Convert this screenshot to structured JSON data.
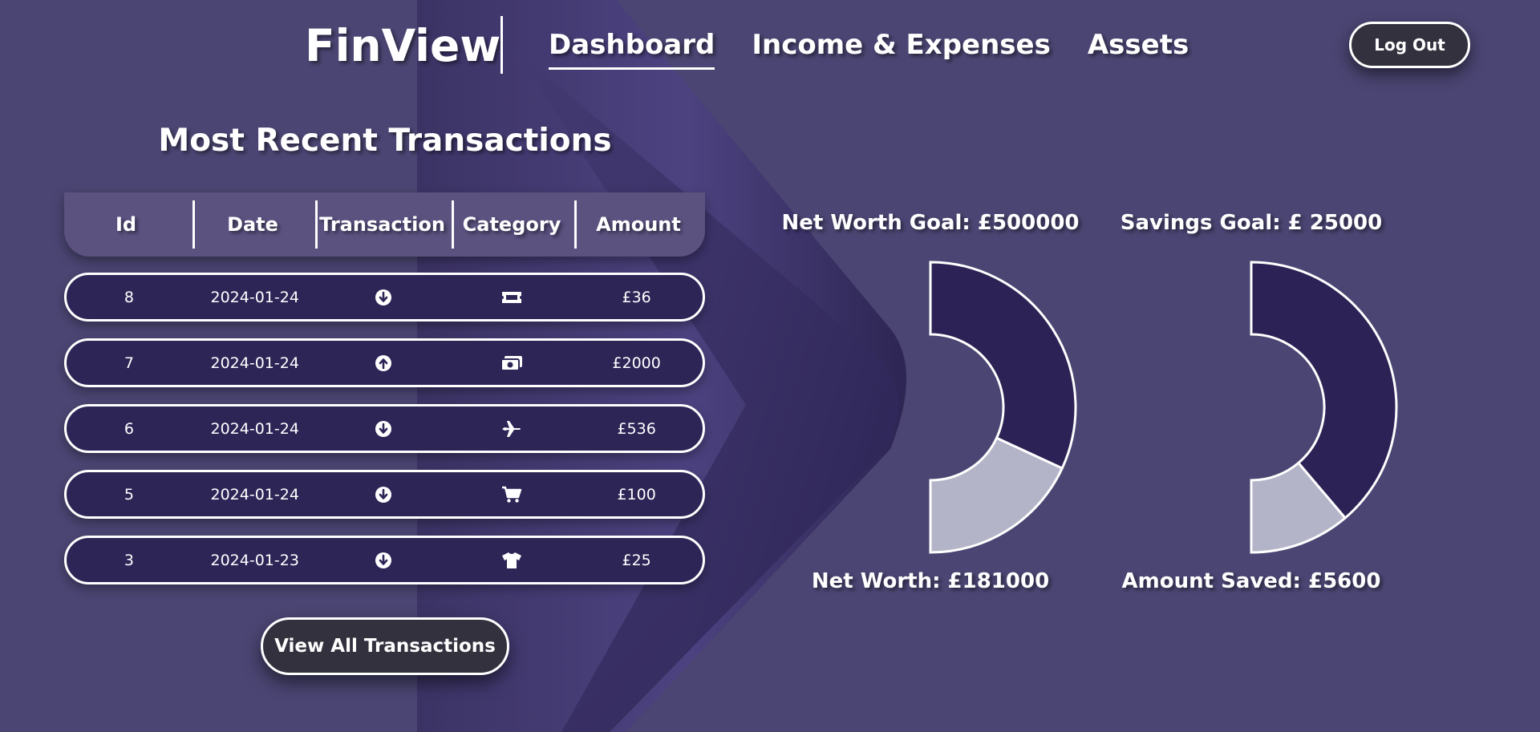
{
  "app": {
    "logo": "FinView"
  },
  "nav": {
    "items": [
      "Dashboard",
      "Income & Expenses",
      "Assets"
    ],
    "active": "Dashboard"
  },
  "logout_label": "Log Out",
  "transactions": {
    "title": "Most Recent Transactions",
    "columns": [
      "Id",
      "Date",
      "Transaction",
      "Category",
      "Amount"
    ],
    "rows": [
      {
        "id": "8",
        "date": "2024-01-24",
        "direction": "arrow-down-circle-icon",
        "category": "ticket-icon",
        "amount": "£36"
      },
      {
        "id": "7",
        "date": "2024-01-24",
        "direction": "arrow-up-circle-icon",
        "category": "money-icon",
        "amount": "£2000"
      },
      {
        "id": "6",
        "date": "2024-01-24",
        "direction": "arrow-down-circle-icon",
        "category": "plane-icon",
        "amount": "£536"
      },
      {
        "id": "5",
        "date": "2024-01-24",
        "direction": "arrow-down-circle-icon",
        "category": "cart-icon",
        "amount": "£100"
      },
      {
        "id": "3",
        "date": "2024-01-23",
        "direction": "arrow-down-circle-icon",
        "category": "shirt-icon",
        "amount": "£25"
      }
    ],
    "view_all_label": "View All Transactions"
  },
  "goals": {
    "net_worth": {
      "goal_label": "Net Worth Goal: £500000",
      "value_label": "Net Worth: £181000",
      "goal": 500000,
      "value": 181000
    },
    "savings": {
      "goal_label": "Savings Goal: £ 25000",
      "value_label": "Amount Saved: £5600",
      "goal": 25000,
      "value": 5600
    }
  },
  "colors": {
    "background": "#4a4572",
    "arrow": "#372c63",
    "row_fill": "#2e2557",
    "donut_remaining": "#2c2255",
    "donut_achieved": "#b3b4c8",
    "button_fill": "#33313d"
  }
}
